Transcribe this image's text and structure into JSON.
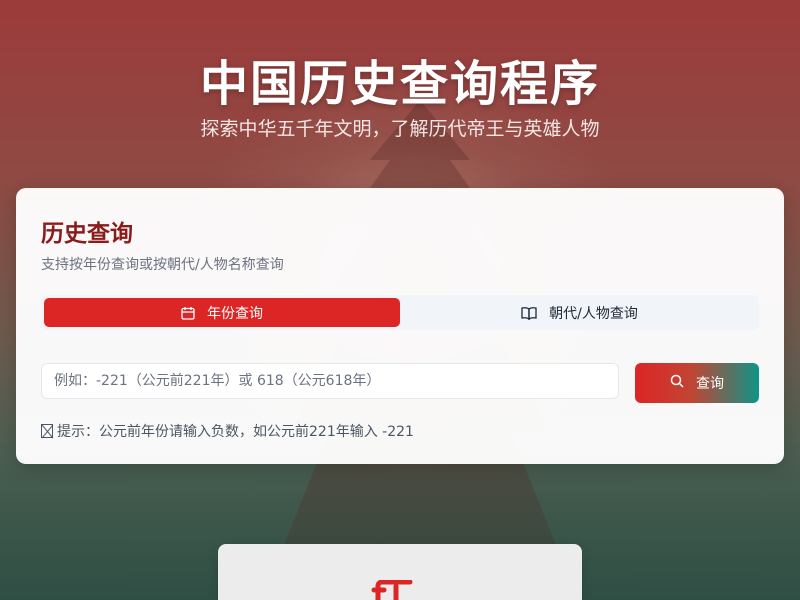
{
  "header": {
    "title": "中国历史查询程序",
    "subtitle": "探索中华五千年文明，了解历代帝王与英雄人物"
  },
  "query_card": {
    "title": "历史查询",
    "description": "支持按年份查询或按朝代/人物名称查询",
    "tabs": [
      {
        "label": "年份查询",
        "icon": "calendar-icon",
        "active": true
      },
      {
        "label": "朝代/人物查询",
        "icon": "book-open-icon",
        "active": false
      }
    ],
    "search": {
      "placeholder": "例如：-221（公元前221年）或 618（公元618年）",
      "value": ""
    },
    "query_button": {
      "label": "查询",
      "icon": "search-icon"
    },
    "hint": "提示：公元前年份请输入负数，如公元前221年输入 -221"
  },
  "result_card": {
    "icon": "scroll-icon"
  },
  "colors": {
    "accent_red": "#dc2626",
    "title_dark_red": "#8b1a1a",
    "button_gradient_end": "#0f9488"
  }
}
